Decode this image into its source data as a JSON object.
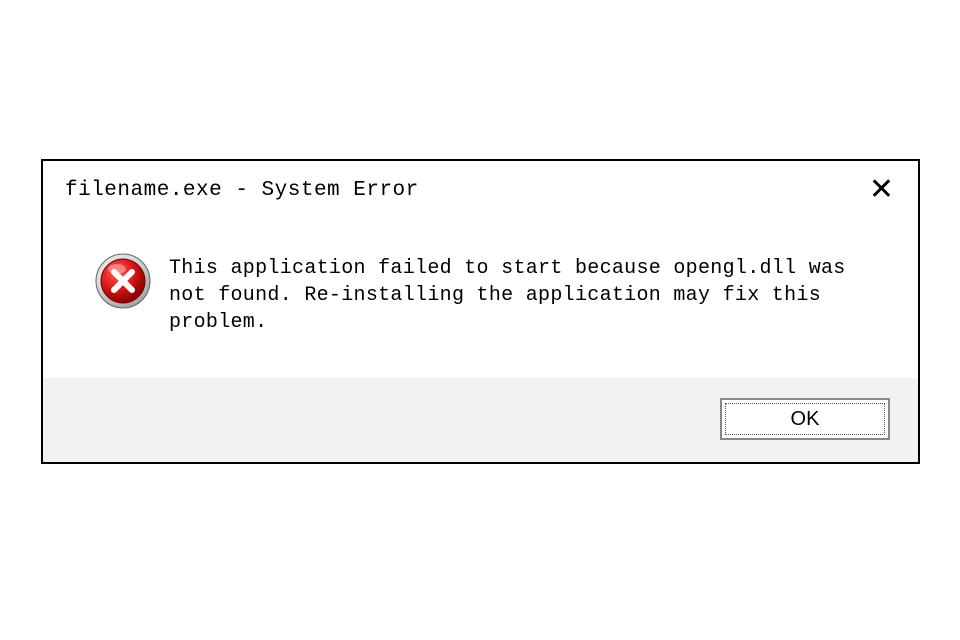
{
  "dialog": {
    "title": "filename.exe - System Error",
    "message": "This application failed to start because opengl.dll was not found. Re-installing the application may fix this problem.",
    "ok_label": "OK"
  }
}
